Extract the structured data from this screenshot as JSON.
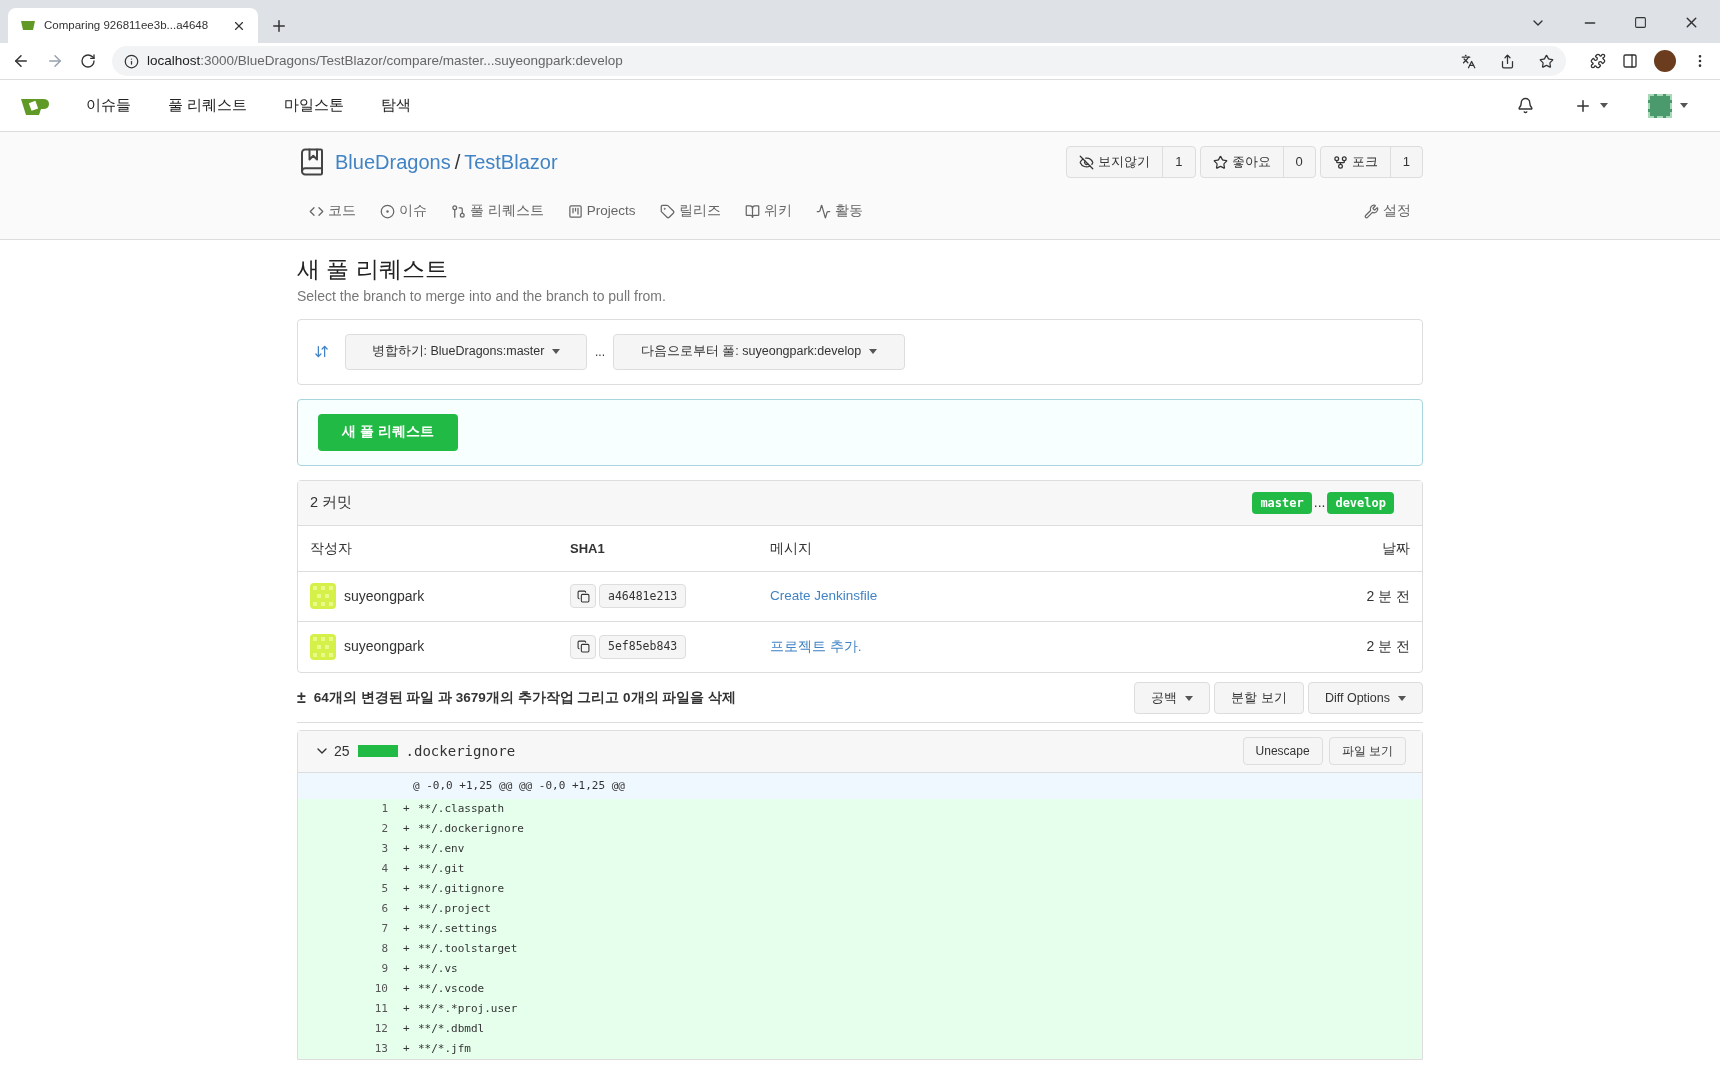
{
  "browser": {
    "tab_title": "Comparing 926811ee3b...a4648",
    "url_host": "localhost",
    "url_path": ":3000/BlueDragons/TestBlazor/compare/master...suyeongpark:develop"
  },
  "nav": {
    "items": [
      "이슈들",
      "풀 리퀘스트",
      "마일스톤",
      "탐색"
    ]
  },
  "repo": {
    "owner": "BlueDragons",
    "separator": "/",
    "name": "TestBlazor",
    "actions": [
      {
        "kind": "watch",
        "label": "보지않기",
        "count": "1"
      },
      {
        "kind": "star",
        "label": "좋아요",
        "count": "0"
      },
      {
        "kind": "fork",
        "label": "포크",
        "count": "1"
      }
    ],
    "tabs": [
      {
        "kind": "code",
        "label": "코드",
        "selected": false
      },
      {
        "kind": "issues",
        "label": "이슈",
        "selected": false
      },
      {
        "kind": "pulls",
        "label": "풀 리퀘스트",
        "selected": false
      },
      {
        "kind": "projects",
        "label": "Projects",
        "selected": false
      },
      {
        "kind": "releases",
        "label": "릴리즈",
        "selected": false
      },
      {
        "kind": "wiki",
        "label": "위키",
        "selected": false
      },
      {
        "kind": "activity",
        "label": "활동",
        "selected": false
      }
    ],
    "settings": "설정"
  },
  "page": {
    "title": "새 풀 리퀘스트",
    "subtitle": "Select the branch to merge into and the branch to pull from."
  },
  "compare": {
    "base": "병합하기: BlueDragons:master",
    "separator": "...",
    "head": "다음으로부터 풀: suyeongpark:develop"
  },
  "new_pr_button": "새 풀 리퀘스트",
  "commits": {
    "count": "2 커밋",
    "base_branch": "master",
    "separator": "...",
    "head_branch": "develop",
    "columns": [
      "작성자",
      "SHA1",
      "메시지",
      "날짜"
    ],
    "rows": [
      {
        "author": "suyeongpark",
        "sha": "a46481e213",
        "message": "Create Jenkinsfile",
        "date": "2 분 전"
      },
      {
        "author": "suyeongpark",
        "sha": "5ef85eb843",
        "message": "프로젝트 추가.",
        "date": "2 분 전"
      }
    ]
  },
  "diff_stats": {
    "sign": "±",
    "text": "64개의 변경된 파일 과 3679개의 추가작업 그리고 0개의 파일을 삭제",
    "buttons": [
      {
        "label": "공백",
        "dropdown": true
      },
      {
        "label": "분할 보기",
        "dropdown": false
      },
      {
        "label": "Diff Options",
        "dropdown": true
      }
    ]
  },
  "file": {
    "expanded": true,
    "additions": "25",
    "name": ".dockerignore",
    "buttons": [
      "Unescape",
      "파일 보기"
    ],
    "hunk": "@ -0,0 +1,25 @@ @@ -0,0 +1,25 @@",
    "lines": [
      {
        "number": "1",
        "sign": "+",
        "text": "**/.classpath"
      },
      {
        "number": "2",
        "sign": "+",
        "text": "**/.dockerignore"
      },
      {
        "number": "3",
        "sign": "+",
        "text": "**/.env"
      },
      {
        "number": "4",
        "sign": "+",
        "text": "**/.git"
      },
      {
        "number": "5",
        "sign": "+",
        "text": "**/.gitignore"
      },
      {
        "number": "6",
        "sign": "+",
        "text": "**/.project"
      },
      {
        "number": "7",
        "sign": "+",
        "text": "**/.settings"
      },
      {
        "number": "8",
        "sign": "+",
        "text": "**/.toolstarget"
      },
      {
        "number": "9",
        "sign": "+",
        "text": "**/.vs"
      },
      {
        "number": "10",
        "sign": "+",
        "text": "**/.vscode"
      },
      {
        "number": "11",
        "sign": "+",
        "text": "**/*.*proj.user"
      },
      {
        "number": "12",
        "sign": "+",
        "text": "**/*.dbmdl"
      },
      {
        "number": "13",
        "sign": "+",
        "text": "**/*.jfm"
      }
    ]
  }
}
